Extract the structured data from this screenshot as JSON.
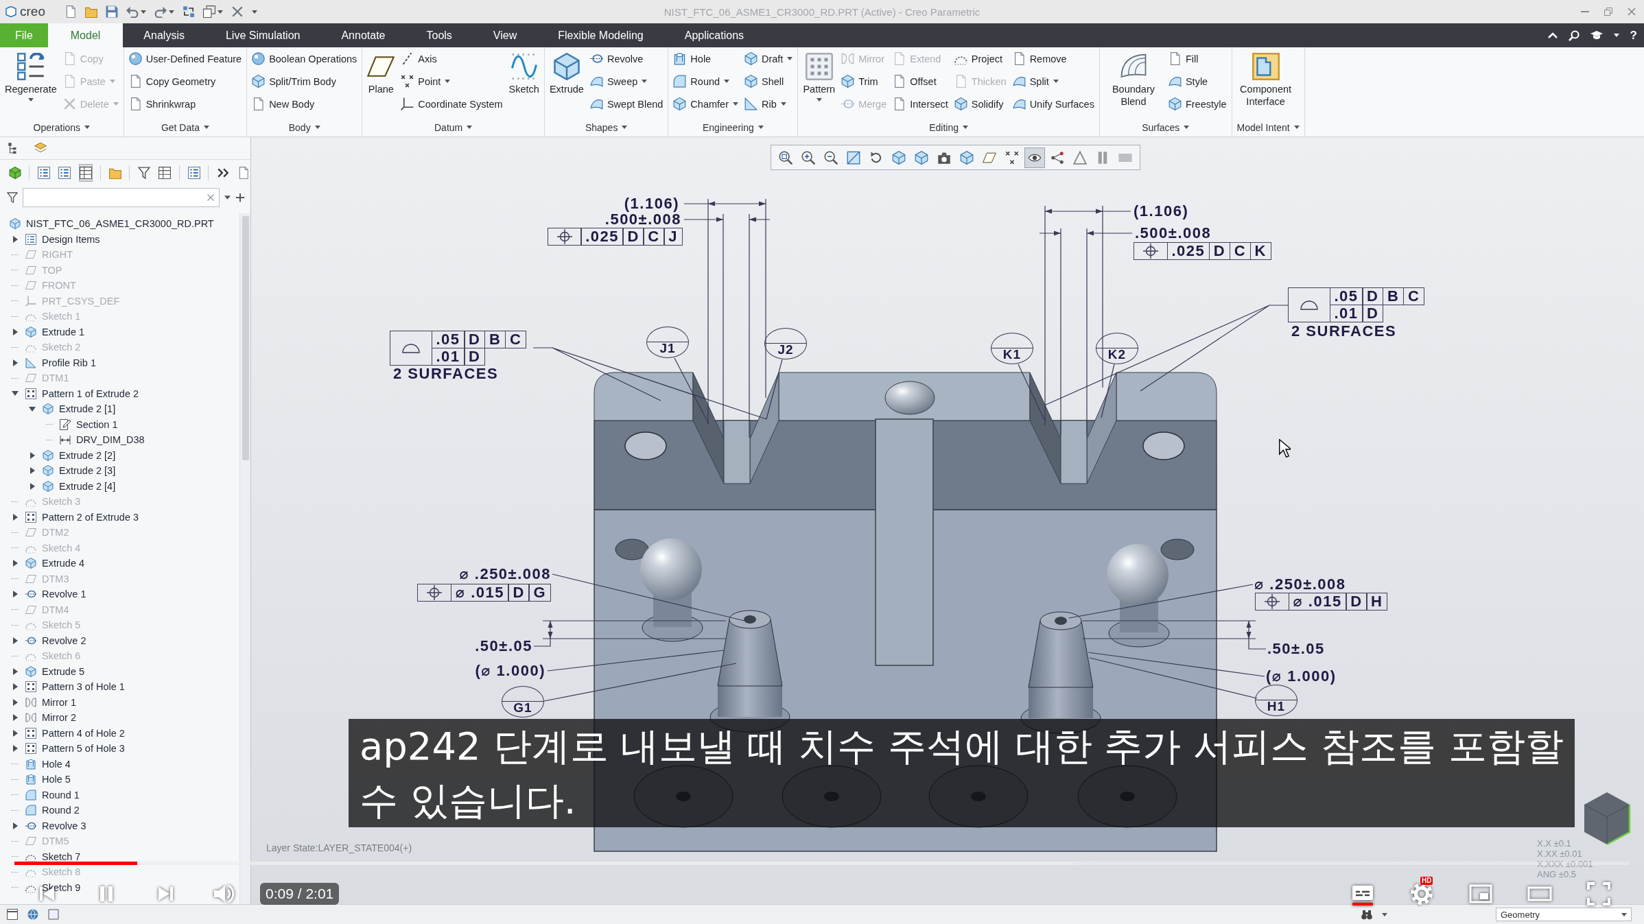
{
  "window": {
    "logo": "creo",
    "title": "NIST_FTC_06_ASME1_CR3000_RD.PRT (Active) - Creo Parametric"
  },
  "tabs": [
    {
      "label": "File",
      "kind": "file",
      "selected": false
    },
    {
      "label": "Model",
      "kind": "tab",
      "selected": true
    },
    {
      "label": "Analysis",
      "kind": "tab",
      "selected": false
    },
    {
      "label": "Live Simulation",
      "kind": "tab",
      "selected": false
    },
    {
      "label": "Annotate",
      "kind": "tab",
      "selected": false
    },
    {
      "label": "Tools",
      "kind": "tab",
      "selected": false
    },
    {
      "label": "View",
      "kind": "tab",
      "selected": false
    },
    {
      "label": "Flexible Modeling",
      "kind": "tab",
      "selected": false
    },
    {
      "label": "Applications",
      "kind": "tab",
      "selected": false
    }
  ],
  "help": "?",
  "ribbon": [
    {
      "label": "Operations",
      "columns": [
        [
          {
            "label": "Regenerate",
            "kind": "large",
            "disabled": false,
            "dropdown": true
          }
        ],
        [
          {
            "label": "Copy",
            "kind": "small",
            "disabled": true,
            "dropdown": false
          },
          {
            "label": "Paste",
            "kind": "small",
            "disabled": true,
            "dropdown": true
          },
          {
            "label": "Delete",
            "kind": "small",
            "disabled": true,
            "dropdown": true
          }
        ]
      ]
    },
    {
      "label": "Get Data",
      "columns": [
        [
          {
            "label": "User-Defined Feature",
            "kind": "small",
            "disabled": false,
            "dropdown": false
          },
          {
            "label": "Copy Geometry",
            "kind": "small",
            "disabled": false,
            "dropdown": false
          },
          {
            "label": "Shrinkwrap",
            "kind": "small",
            "disabled": false,
            "dropdown": false
          }
        ]
      ]
    },
    {
      "label": "Body",
      "columns": [
        [
          {
            "label": "Boolean Operations",
            "kind": "small",
            "disabled": false,
            "dropdown": false
          },
          {
            "label": "Split/Trim Body",
            "kind": "small",
            "disabled": false,
            "dropdown": false
          },
          {
            "label": "New Body",
            "kind": "small",
            "disabled": false,
            "dropdown": false
          }
        ]
      ]
    },
    {
      "label": "Datum",
      "columns": [
        [
          {
            "label": "Plane",
            "kind": "large",
            "disabled": false,
            "dropdown": false
          }
        ],
        [
          {
            "label": "Axis",
            "kind": "small",
            "disabled": false,
            "dropdown": false
          },
          {
            "label": "Point",
            "kind": "small",
            "disabled": false,
            "dropdown": true
          },
          {
            "label": "Coordinate System",
            "kind": "small",
            "disabled": false,
            "dropdown": false
          }
        ],
        [
          {
            "label": "Sketch",
            "kind": "large",
            "disabled": false,
            "dropdown": false
          }
        ]
      ]
    },
    {
      "label": "Shapes",
      "columns": [
        [
          {
            "label": "Extrude",
            "kind": "large",
            "disabled": false,
            "dropdown": false
          }
        ],
        [
          {
            "label": "Revolve",
            "kind": "small",
            "disabled": false,
            "dropdown": false
          },
          {
            "label": "Sweep",
            "kind": "small",
            "disabled": false,
            "dropdown": true
          },
          {
            "label": "Swept Blend",
            "kind": "small",
            "disabled": false,
            "dropdown": false
          }
        ]
      ]
    },
    {
      "label": "Engineering",
      "columns": [
        [
          {
            "label": "Hole",
            "kind": "small",
            "disabled": false,
            "dropdown": false
          },
          {
            "label": "Round",
            "kind": "small",
            "disabled": false,
            "dropdown": true
          },
          {
            "label": "Chamfer",
            "kind": "small",
            "disabled": false,
            "dropdown": true
          }
        ],
        [
          {
            "label": "Draft",
            "kind": "small",
            "disabled": false,
            "dropdown": true
          },
          {
            "label": "Shell",
            "kind": "small",
            "disabled": false,
            "dropdown": false
          },
          {
            "label": "Rib",
            "kind": "small",
            "disabled": false,
            "dropdown": true
          }
        ]
      ]
    },
    {
      "label": "Editing",
      "columns": [
        [
          {
            "label": "Pattern",
            "kind": "large",
            "disabled": false,
            "dropdown": true
          }
        ],
        [
          {
            "label": "Mirror",
            "kind": "small",
            "disabled": true,
            "dropdown": false
          },
          {
            "label": "Trim",
            "kind": "small",
            "disabled": false,
            "dropdown": false
          },
          {
            "label": "Merge",
            "kind": "small",
            "disabled": true,
            "dropdown": false
          }
        ],
        [
          {
            "label": "Extend",
            "kind": "small",
            "disabled": true,
            "dropdown": false
          },
          {
            "label": "Offset",
            "kind": "small",
            "disabled": false,
            "dropdown": false
          },
          {
            "label": "Intersect",
            "kind": "small",
            "disabled": false,
            "dropdown": false
          }
        ],
        [
          {
            "label": "Project",
            "kind": "small",
            "disabled": false,
            "dropdown": false
          },
          {
            "label": "Thicken",
            "kind": "small",
            "disabled": true,
            "dropdown": false
          },
          {
            "label": "Solidify",
            "kind": "small",
            "disabled": false,
            "dropdown": false
          }
        ],
        [
          {
            "label": "Remove",
            "kind": "small",
            "disabled": false,
            "dropdown": false
          },
          {
            "label": "Split",
            "kind": "small",
            "disabled": false,
            "dropdown": true
          },
          {
            "label": "Unify Surfaces",
            "kind": "small",
            "disabled": false,
            "dropdown": false
          }
        ]
      ]
    },
    {
      "label": "Surfaces",
      "columns": [
        [
          {
            "label": "Boundary Blend",
            "kind": "large",
            "disabled": false,
            "dropdown": false
          }
        ],
        [
          {
            "label": "Fill",
            "kind": "small",
            "disabled": false,
            "dropdown": false
          },
          {
            "label": "Style",
            "kind": "small",
            "disabled": false,
            "dropdown": false
          },
          {
            "label": "Freestyle",
            "kind": "small",
            "disabled": false,
            "dropdown": false
          }
        ]
      ]
    },
    {
      "label": "Model Intent",
      "columns": [
        [
          {
            "label": "Component Interface",
            "kind": "large",
            "disabled": false,
            "dropdown": false
          }
        ]
      ]
    }
  ],
  "model_tree": {
    "toolbar": [
      {
        "pressed": false
      },
      {
        "pressed": false
      },
      {
        "pressed": false
      },
      {
        "pressed": true
      },
      {
        "pressed": false
      },
      {
        "pressed": false
      },
      {
        "pressed": false
      },
      {
        "pressed": false
      },
      {
        "pressed": false
      },
      {
        "pressed": false
      }
    ],
    "root": {
      "label": "NIST_FTC_06_ASME1_CR3000_RD.PRT",
      "kind": "part"
    },
    "items": [
      {
        "label": "Design Items",
        "kind": "folder",
        "dimmed": false,
        "expanded": false
      },
      {
        "label": "RIGHT",
        "kind": "plane",
        "dimmed": true
      },
      {
        "label": "TOP",
        "kind": "plane",
        "dimmed": true
      },
      {
        "label": "FRONT",
        "kind": "plane",
        "dimmed": true
      },
      {
        "label": "PRT_CSYS_DEF",
        "kind": "csys",
        "dimmed": true
      },
      {
        "label": "Sketch 1",
        "kind": "sketch",
        "dimmed": true
      },
      {
        "label": "Extrude 1",
        "kind": "extrude",
        "dimmed": false,
        "expanded": false
      },
      {
        "label": "Sketch 2",
        "kind": "sketch",
        "dimmed": true
      },
      {
        "label": "Profile Rib 1",
        "kind": "rib",
        "dimmed": false,
        "expanded": false
      },
      {
        "label": "DTM1",
        "kind": "plane",
        "dimmed": true
      },
      {
        "label": "Pattern 1 of Extrude 2",
        "kind": "pattern",
        "dimmed": false,
        "expanded": true,
        "children": [
          {
            "label": "Extrude 2 [1]",
            "kind": "extrude",
            "dimmed": false,
            "expanded": true,
            "children": [
              {
                "label": "Section 1",
                "kind": "section",
                "dimmed": false
              },
              {
                "label": "DRV_DIM_D38",
                "kind": "dimension",
                "dimmed": false
              }
            ]
          },
          {
            "label": "Extrude 2 [2]",
            "kind": "extrude",
            "dimmed": false,
            "expanded": false
          },
          {
            "label": "Extrude 2 [3]",
            "kind": "extrude",
            "dimmed": false,
            "expanded": false
          },
          {
            "label": "Extrude 2 [4]",
            "kind": "extrude",
            "dimmed": false,
            "expanded": false
          }
        ]
      },
      {
        "label": "Sketch 3",
        "kind": "sketch",
        "dimmed": true
      },
      {
        "label": "Pattern 2 of Extrude 3",
        "kind": "pattern",
        "dimmed": false,
        "expanded": false
      },
      {
        "label": "DTM2",
        "kind": "plane",
        "dimmed": true
      },
      {
        "label": "Sketch 4",
        "kind": "sketch",
        "dimmed": true
      },
      {
        "label": "Extrude 4",
        "kind": "extrude",
        "dimmed": false,
        "expanded": false
      },
      {
        "label": "DTM3",
        "kind": "plane",
        "dimmed": true
      },
      {
        "label": "Revolve 1",
        "kind": "revolve",
        "dimmed": false,
        "expanded": false
      },
      {
        "label": "DTM4",
        "kind": "plane",
        "dimmed": true
      },
      {
        "label": "Sketch 5",
        "kind": "sketch",
        "dimmed": true
      },
      {
        "label": "Revolve 2",
        "kind": "revolve",
        "dimmed": false,
        "expanded": false
      },
      {
        "label": "Sketch 6",
        "kind": "sketch",
        "dimmed": true
      },
      {
        "label": "Extrude 5",
        "kind": "extrude",
        "dimmed": false,
        "expanded": false
      },
      {
        "label": "Pattern 3 of Hole 1",
        "kind": "pattern",
        "dimmed": false,
        "expanded": false
      },
      {
        "label": "Mirror 1",
        "kind": "mirror",
        "dimmed": false,
        "expanded": false
      },
      {
        "label": "Mirror 2",
        "kind": "mirror",
        "dimmed": false,
        "expanded": false
      },
      {
        "label": "Pattern 4 of Hole 2",
        "kind": "pattern",
        "dimmed": false,
        "expanded": false
      },
      {
        "label": "Pattern 5 of Hole 3",
        "kind": "pattern",
        "dimmed": false,
        "expanded": false
      },
      {
        "label": "Hole 4",
        "kind": "hole",
        "dimmed": false
      },
      {
        "label": "Hole 5",
        "kind": "hole",
        "dimmed": false
      },
      {
        "label": "Round 1",
        "kind": "round",
        "dimmed": false
      },
      {
        "label": "Round 2",
        "kind": "round",
        "dimmed": false
      },
      {
        "label": "Revolve 3",
        "kind": "revolve",
        "dimmed": false,
        "expanded": false
      },
      {
        "label": "DTM5",
        "kind": "plane",
        "dimmed": true
      },
      {
        "label": "Sketch 7",
        "kind": "sketch",
        "dimmed": false
      },
      {
        "label": "Sketch 8",
        "kind": "sketch",
        "dimmed": true
      },
      {
        "label": "Sketch 9",
        "kind": "sketch",
        "dimmed": false
      }
    ]
  },
  "viewport": {
    "graphics_toolbar": [
      {
        "pressed": false
      },
      {
        "pressed": false
      },
      {
        "pressed": false
      },
      {
        "pressed": false
      },
      {
        "pressed": false
      },
      {
        "pressed": false
      },
      {
        "pressed": false
      },
      {
        "pressed": false
      },
      {
        "pressed": false
      },
      {
        "pressed": false
      },
      {
        "pressed": false
      },
      {
        "pressed": true
      },
      {
        "pressed": false
      },
      {
        "pressed": false
      },
      {
        "pressed": false
      },
      {
        "pressed": false
      }
    ],
    "annotations": [
      {
        "kind": "dimension",
        "text": "(1.106)"
      },
      {
        "kind": "dimension",
        "text": ".500±.008"
      },
      {
        "kind": "position_frame",
        "cells": [
          ".025",
          "D",
          "C",
          "J"
        ]
      },
      {
        "kind": "profile_frame",
        "rows": [
          [
            ".05",
            "D",
            "B",
            "C"
          ],
          [
            ".01",
            "D"
          ]
        ]
      },
      {
        "kind": "note",
        "text": "2 SURFACES"
      },
      {
        "kind": "datum_target",
        "text": "J1"
      },
      {
        "kind": "datum_target",
        "text": "J2"
      },
      {
        "kind": "dimension",
        "text": "⌀ .250±.008"
      },
      {
        "kind": "position_frame",
        "cells": [
          "⌀ .015",
          "D",
          "G"
        ]
      },
      {
        "kind": "dimension",
        "text": ".50±.05"
      },
      {
        "kind": "dimension",
        "text": "(⌀ 1.000)"
      },
      {
        "kind": "datum_target",
        "text": "G1"
      },
      {
        "kind": "dimension",
        "text": "(1.106)"
      },
      {
        "kind": "dimension",
        "text": ".500±.008"
      },
      {
        "kind": "position_frame",
        "cells": [
          ".025",
          "D",
          "C",
          "K"
        ]
      },
      {
        "kind": "profile_frame",
        "rows": [
          [
            ".05",
            "D",
            "B",
            "C"
          ],
          [
            ".01",
            "D"
          ]
        ]
      },
      {
        "kind": "note",
        "text": "2 SURFACES"
      },
      {
        "kind": "datum_target",
        "text": "K1"
      },
      {
        "kind": "datum_target",
        "text": "K2"
      },
      {
        "kind": "dimension",
        "text": "⌀ .250±.008"
      },
      {
        "kind": "position_frame",
        "cells": [
          "⌀ .015",
          "D",
          "H"
        ]
      },
      {
        "kind": "dimension",
        "text": ".50±.05"
      },
      {
        "kind": "dimension",
        "text": "(⌀ 1.000)"
      },
      {
        "kind": "datum_target",
        "text": "H1"
      }
    ],
    "layer_state": "Layer State:LAYER_STATE004(+)",
    "tolerances": [
      "X.X ±0.1",
      "X.XX ±0.01",
      "X.XXX ±0.001",
      "ANG ±0.5"
    ]
  },
  "status_bar": {
    "filter": "Geometry"
  },
  "player": {
    "caption": [
      "ap242 단계로 내보낼 때 치수 주석에 대한 추가 서피스 참조를 포함할",
      "수 있습니다."
    ],
    "progress": {
      "level": 0.076
    },
    "buffer": {
      "level": 0.657
    },
    "time": "0:09 / 2:01",
    "captions_on": true,
    "quality_badge": "HD"
  }
}
